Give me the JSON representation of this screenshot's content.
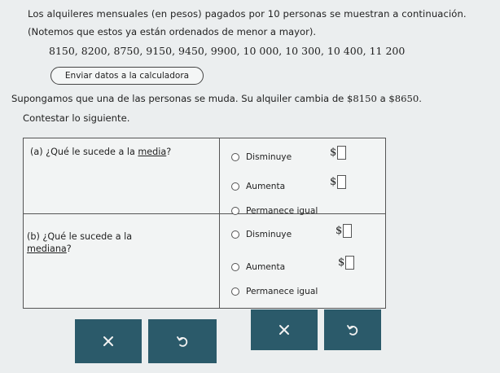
{
  "intro": {
    "line1": "Los alquileres mensuales (en pesos) pagados por 10 personas se muestran a continuación.",
    "line2": "(Notemos que estos ya están ordenados de menor a mayor).",
    "numbers": "8150, 8200, 8750, 9150, 9450, 9900, 10 000, 10 300, 10 400, 11 200"
  },
  "calculator_button": "Enviar datos a la calculadora",
  "scenario": {
    "text": "Supongamos que una de las personas se muda. Su alquiler cambia de ",
    "from": "$8150",
    "a": " a ",
    "to": "$8650."
  },
  "instruction": "Contestar lo siguiente.",
  "question_a": {
    "prefix": "(a)   ¿Qué le sucede a la ",
    "link": "media",
    "suffix": "?",
    "options": [
      "Disminuye",
      "Aumenta",
      "Permanece igual"
    ],
    "currency": "$"
  },
  "question_b": {
    "prefix": "(b)   ¿Qué le sucede a la",
    "link": "mediana",
    "suffix": "?",
    "options": [
      "Disminuye",
      "Aumenta",
      "Permanece igual"
    ],
    "currency": "$"
  },
  "colors": {
    "button_bg": "#2b5a6a",
    "page_bg": "#ebeeef"
  },
  "actions": {
    "clear_icon": "close-icon",
    "undo_icon": "undo-icon"
  }
}
